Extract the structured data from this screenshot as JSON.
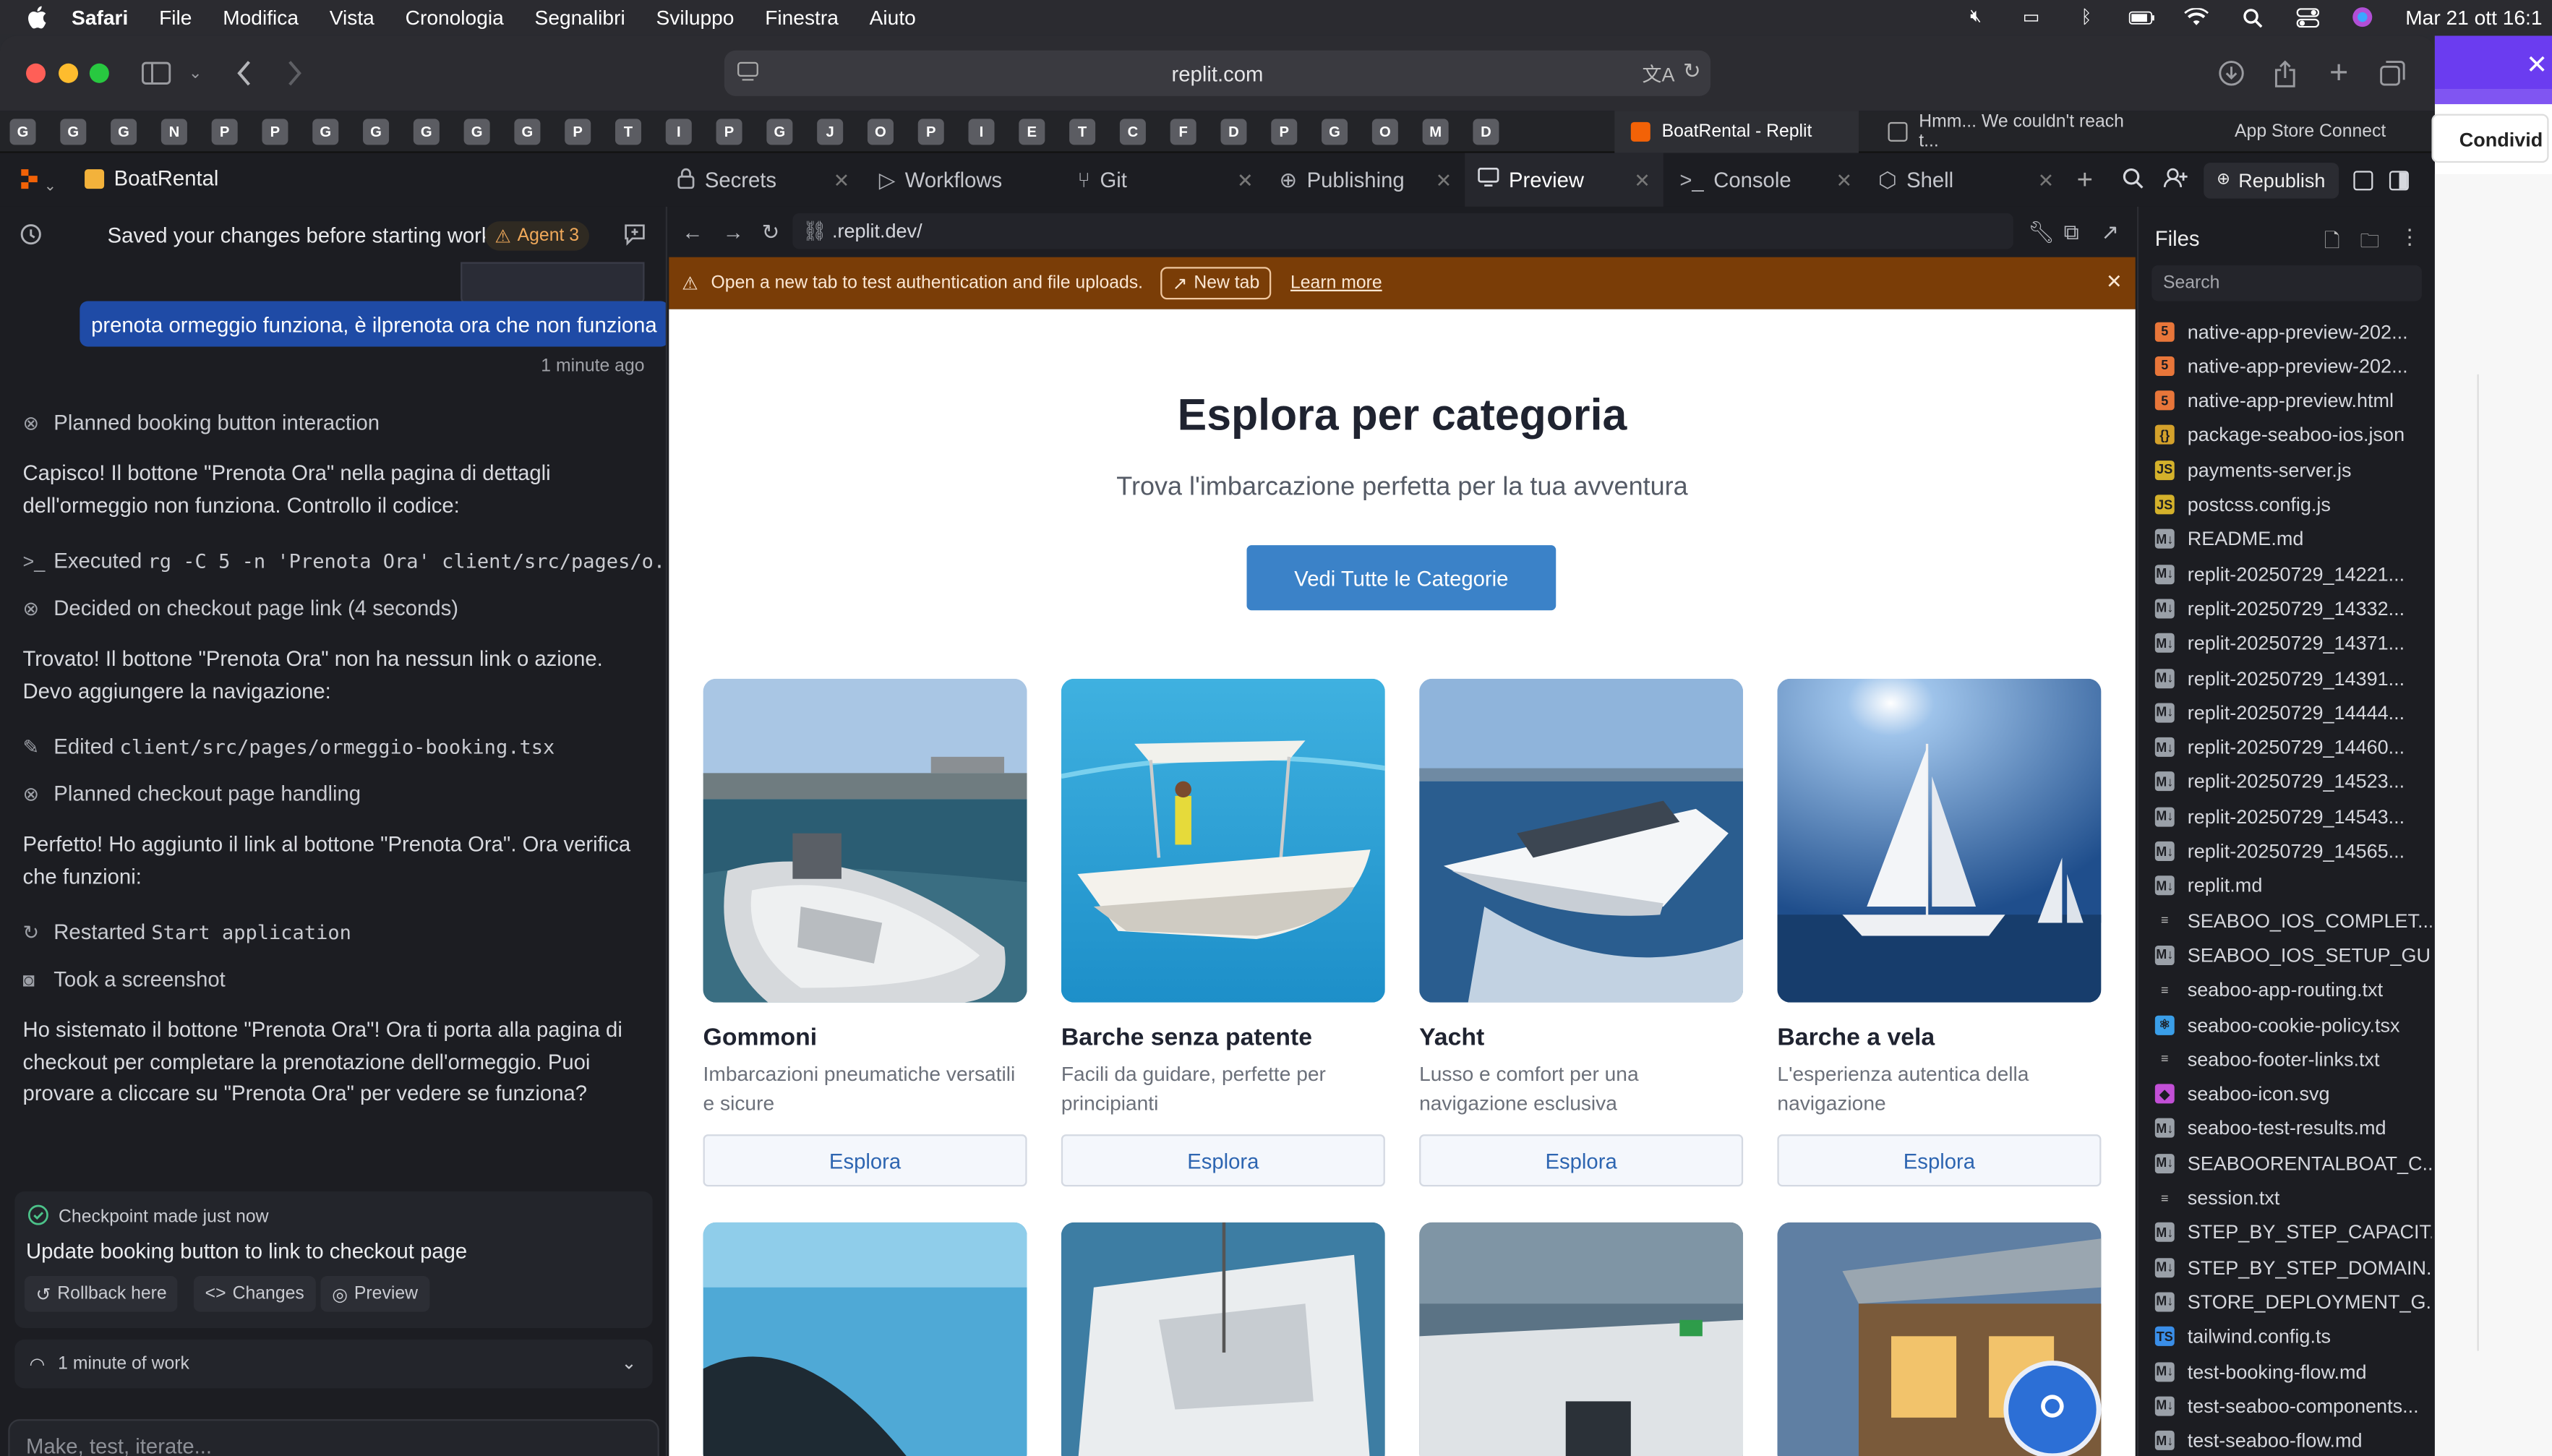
{
  "menubar": {
    "items": [
      "Safari",
      "File",
      "Modifica",
      "Vista",
      "Cronologia",
      "Segnalibri",
      "Sviluppo",
      "Finestra",
      "Aiuto"
    ],
    "clock": "Mar 21 ott 16:1"
  },
  "browser": {
    "url": "replit.com",
    "pinned_tabs": [
      "G",
      "G",
      "G",
      "N",
      "P",
      "P",
      "G",
      "G",
      "G",
      "G",
      "G",
      "P",
      "T",
      "I",
      "P",
      "G",
      "J",
      "O",
      "P",
      "I",
      "E",
      "T",
      "C",
      "F",
      "D",
      "P",
      "G",
      "O",
      "M",
      "D"
    ],
    "tabs": [
      {
        "label": "BoatRental - Replit",
        "active": true
      },
      {
        "label": "Hmm... We couldn't reach t...",
        "active": false
      },
      {
        "label": "App Store Connect",
        "active": false
      }
    ]
  },
  "replit": {
    "project_name": "BoatRental",
    "workspace_tabs": [
      {
        "label": "Secrets",
        "icon": "lock-icon"
      },
      {
        "label": "Workflows",
        "icon": "play-icon"
      },
      {
        "label": "Git",
        "icon": "git-icon"
      },
      {
        "label": "Publishing",
        "icon": "globe-icon"
      },
      {
        "label": "Preview",
        "icon": "monitor-icon",
        "active": true
      },
      {
        "label": "Console",
        "icon": "terminal-icon"
      },
      {
        "label": "Shell",
        "icon": "shell-icon"
      }
    ],
    "republish_label": "Republish"
  },
  "chat": {
    "header": "Saved your changes before starting work",
    "agent_badge": "Agent 3",
    "user_message": "prenota ormeggio funziona, è ilprenota ora che non funziona",
    "user_time": "1 minute ago",
    "entries": [
      {
        "type": "step",
        "text": "Planned booking button interaction"
      },
      {
        "type": "text",
        "text": "Capisco! Il bottone \"Prenota Ora\" nella pagina di dettagli dell'ormeggio non funziona. Controllo il codice:"
      },
      {
        "type": "step_code",
        "prefix": "Executed ",
        "code": "rg -C 5 -n 'Prenota Ora' client/src/pages/o..."
      },
      {
        "type": "step",
        "text": "Decided on checkout page link (4 seconds)"
      },
      {
        "type": "text",
        "text": "Trovato! Il bottone \"Prenota Ora\" non ha nessun link o azione. Devo aggiungere la navigazione:"
      },
      {
        "type": "step_code",
        "prefix": "Edited ",
        "code": "client/src/pages/ormeggio-booking.tsx"
      },
      {
        "type": "step",
        "text": "Planned checkout page handling"
      },
      {
        "type": "text",
        "text": "Perfetto! Ho aggiunto il link al bottone \"Prenota Ora\". Ora verifica che funzioni:"
      },
      {
        "type": "step_code",
        "prefix": "Restarted ",
        "code": "Start application"
      },
      {
        "type": "step",
        "text": "Took a screenshot"
      },
      {
        "type": "text",
        "text": "Ho sistemato il bottone \"Prenota Ora\"! Ora ti porta alla pagina di checkout per completare la prenotazione dell'ormeggio. Puoi provare a cliccare su \"Prenota Ora\" per vedere se funziona?"
      }
    ],
    "checkpoint": {
      "status": "Checkpoint made just now",
      "title": "Update booking button to link to checkout page",
      "buttons": [
        "Rollback here",
        "Changes",
        "Preview"
      ]
    },
    "work_summary": "1 minute of work",
    "input_placeholder": "Make, test, iterate..."
  },
  "preview": {
    "address": ".replit.dev/",
    "warning": "Open a new tab to test authentication and file uploads.",
    "new_tab_label": "New tab",
    "learn_more": "Learn more",
    "site": {
      "title": "Esplora per categoria",
      "subtitle": "Trova l'imbarcazione perfetta per la tua avventura",
      "cta": "Vedi Tutte le Categorie",
      "categories": [
        {
          "title": "Gommoni",
          "desc": "Imbarcazioni pneumatiche versatili e sicure",
          "button": "Esplora"
        },
        {
          "title": "Barche senza patente",
          "desc": "Facili da guidare, perfette per principianti",
          "button": "Esplora"
        },
        {
          "title": "Yacht",
          "desc": "Lusso e comfort per una navigazione esclusiva",
          "button": "Esplora"
        },
        {
          "title": "Barche a vela",
          "desc": "L'esperienza autentica della navigazione",
          "button": "Esplora"
        }
      ]
    }
  },
  "files": {
    "title": "Files",
    "search_placeholder": "Search",
    "items": [
      {
        "name": "native-app-preview-202...",
        "kind": "html"
      },
      {
        "name": "native-app-preview-202...",
        "kind": "html"
      },
      {
        "name": "native-app-preview.html",
        "kind": "html"
      },
      {
        "name": "package-seaboo-ios.json",
        "kind": "json"
      },
      {
        "name": "payments-server.js",
        "kind": "js"
      },
      {
        "name": "postcss.config.js",
        "kind": "js"
      },
      {
        "name": "README.md",
        "kind": "md"
      },
      {
        "name": "replit-20250729_14221...",
        "kind": "md"
      },
      {
        "name": "replit-20250729_14332...",
        "kind": "md"
      },
      {
        "name": "replit-20250729_14371...",
        "kind": "md"
      },
      {
        "name": "replit-20250729_14391...",
        "kind": "md"
      },
      {
        "name": "replit-20250729_14444...",
        "kind": "md"
      },
      {
        "name": "replit-20250729_14460...",
        "kind": "md"
      },
      {
        "name": "replit-20250729_14523...",
        "kind": "md"
      },
      {
        "name": "replit-20250729_14543...",
        "kind": "md"
      },
      {
        "name": "replit-20250729_14565...",
        "kind": "md"
      },
      {
        "name": "replit.md",
        "kind": "md"
      },
      {
        "name": "SEABOO_IOS_COMPLET...",
        "kind": "txt"
      },
      {
        "name": "SEABOO_IOS_SETUP_GU...",
        "kind": "md"
      },
      {
        "name": "seaboo-app-routing.txt",
        "kind": "txt"
      },
      {
        "name": "seaboo-cookie-policy.tsx",
        "kind": "tsx"
      },
      {
        "name": "seaboo-footer-links.txt",
        "kind": "txt"
      },
      {
        "name": "seaboo-icon.svg",
        "kind": "svg"
      },
      {
        "name": "seaboo-test-results.md",
        "kind": "md"
      },
      {
        "name": "SEABOORENTALBOAT_C...",
        "kind": "md"
      },
      {
        "name": "session.txt",
        "kind": "txt"
      },
      {
        "name": "STEP_BY_STEP_CAPACIT...",
        "kind": "md"
      },
      {
        "name": "STEP_BY_STEP_DOMAIN...",
        "kind": "md"
      },
      {
        "name": "STORE_DEPLOYMENT_G...",
        "kind": "md"
      },
      {
        "name": "tailwind.config.ts",
        "kind": "ts"
      },
      {
        "name": "test-booking-flow.md",
        "kind": "md"
      },
      {
        "name": "test-seaboo-components...",
        "kind": "md"
      },
      {
        "name": "test-seaboo-flow.md",
        "kind": "md"
      }
    ]
  },
  "side_window": {
    "label": "Condivid"
  },
  "colors": {
    "accent": "#3b82c8",
    "warning_bar": "#7a3d07",
    "user_bubble": "#1f4ba6",
    "agent_badge": "#f0a95a"
  }
}
